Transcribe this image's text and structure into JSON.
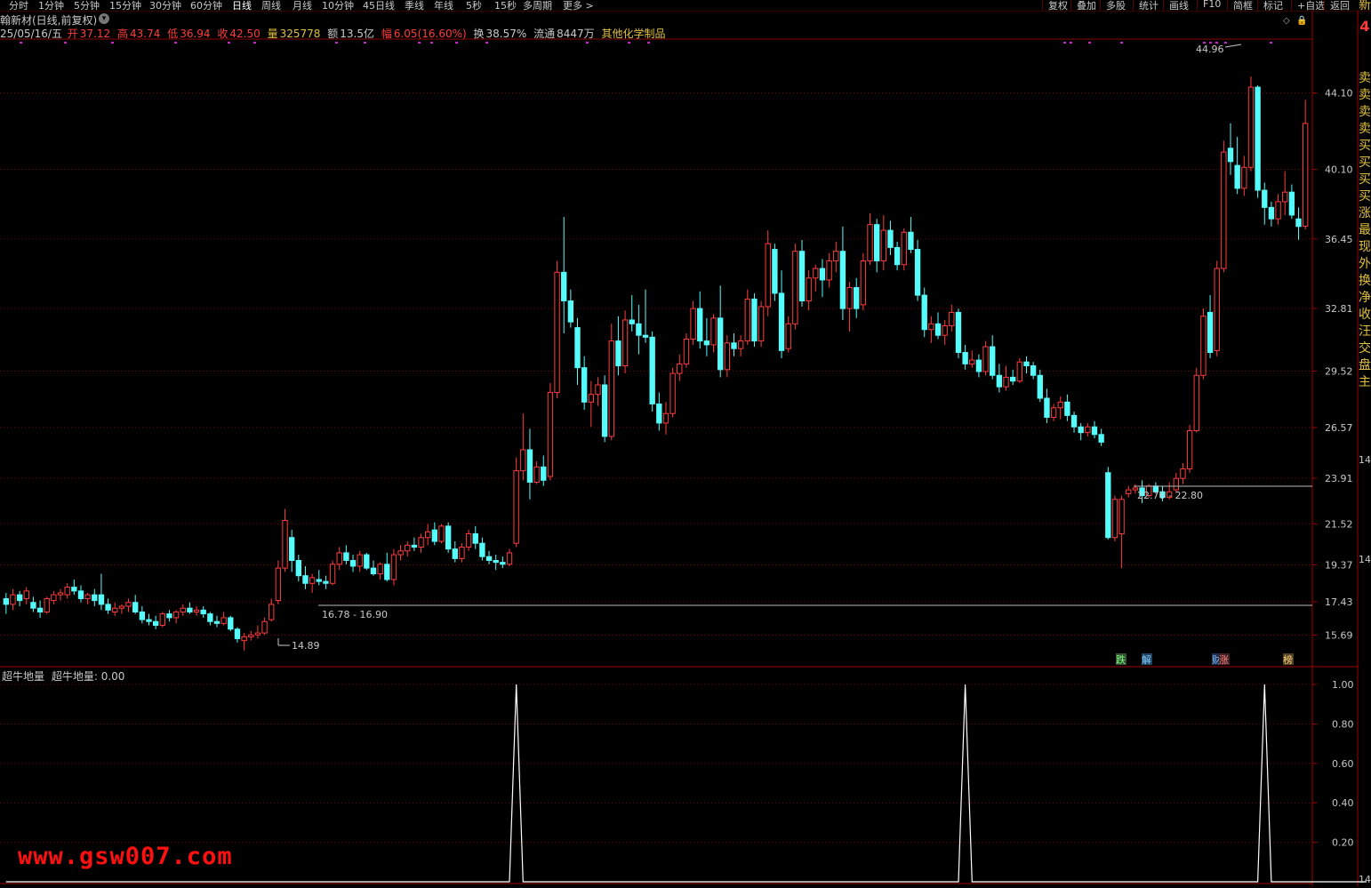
{
  "toolbar": {
    "periods": [
      "分时",
      "1分钟",
      "5分钟",
      "15分钟",
      "30分钟",
      "60分钟",
      "日线",
      "周线",
      "月线",
      "10分钟",
      "45日线",
      "季线",
      "年线",
      "5秒",
      "15秒",
      "多周期",
      "更多 >"
    ],
    "active_period": "日线",
    "right_items": [
      "复权",
      "叠加",
      "多股",
      "统计",
      "画线",
      "F10",
      "简框",
      "标记",
      "+自选",
      "返回"
    ]
  },
  "header": {
    "title": "翰新材(日线,前复权)",
    "info": {
      "date": "25/05/16/五",
      "open_label": "开",
      "open": "37.12",
      "high_label": "高",
      "high": "43.74",
      "low_label": "低",
      "low": "36.94",
      "close_label": "收",
      "close": "42.50",
      "volume_label": "量",
      "volume": "325778",
      "amount_label": "额",
      "amount": "13.5亿",
      "change_label": "幅",
      "change": "6.05(16.60%)",
      "turnover_label": "换",
      "turnover": "38.57%",
      "float_label": "流通",
      "float": "8447万",
      "industry": "其他化学制品"
    }
  },
  "price_axis": [
    "44.10",
    "40.10",
    "36.45",
    "32.81",
    "29.52",
    "26.57",
    "23.91",
    "21.52",
    "19.37",
    "17.43",
    "15.69"
  ],
  "annotations": {
    "high_marker": "44.96",
    "low_marker": "14.89",
    "range_left": "16.78 - 16.90",
    "range_right": "22.76 - 22.80"
  },
  "event_tags": [
    "跌",
    "解",
    "财",
    "涨",
    "榜"
  ],
  "side_panel": {
    "top_label": "新",
    "top_value": "4",
    "labels": [
      "卖",
      "卖",
      "卖",
      "卖",
      "买",
      "买",
      "买",
      "买",
      "涨",
      "最",
      "现",
      "外",
      "换",
      "净",
      "收",
      "汪",
      "交",
      "盘",
      "主"
    ],
    "axis_numbers": [
      "14",
      "14",
      "14"
    ]
  },
  "indicator": {
    "name": "超牛地量",
    "value_label": "超牛地量:",
    "value": "0.00",
    "axis": [
      "1.00",
      "0.80",
      "0.60",
      "0.40",
      "0.20"
    ]
  },
  "watermark": "www.gsw007.com",
  "colors": {
    "up": "#ff3c3c",
    "down": "#54fcfc",
    "grid": "#7a0000",
    "accent": "#e0c040",
    "signal_dot": "#d020d0"
  },
  "chart_data": {
    "type": "candlestick",
    "ylim": [
      14.5,
      46.5
    ],
    "candles": [
      [
        17.6,
        17.9,
        16.8,
        17.3
      ],
      [
        17.3,
        18.1,
        17.0,
        17.8
      ],
      [
        17.8,
        18.0,
        17.2,
        17.5
      ],
      [
        17.6,
        18.2,
        17.3,
        18.0
      ],
      [
        17.4,
        17.7,
        16.9,
        17.1
      ],
      [
        17.1,
        17.5,
        16.6,
        16.9
      ],
      [
        16.9,
        17.7,
        16.8,
        17.6
      ],
      [
        17.5,
        18.0,
        17.3,
        17.8
      ],
      [
        17.8,
        18.1,
        17.5,
        17.9
      ],
      [
        17.8,
        18.4,
        17.6,
        18.2
      ],
      [
        18.2,
        18.6,
        17.8,
        18.0
      ],
      [
        18.0,
        18.3,
        17.4,
        17.6
      ],
      [
        17.6,
        17.9,
        17.3,
        17.8
      ],
      [
        17.8,
        18.1,
        17.2,
        17.5
      ],
      [
        17.8,
        18.9,
        17.0,
        17.3
      ],
      [
        17.3,
        17.6,
        16.8,
        17.0
      ],
      [
        16.9,
        17.4,
        16.7,
        17.1
      ],
      [
        17.1,
        17.3,
        16.8,
        17.2
      ],
      [
        17.2,
        17.6,
        16.9,
        17.4
      ],
      [
        17.4,
        17.8,
        16.8,
        16.9
      ],
      [
        16.9,
        17.2,
        16.3,
        16.5
      ],
      [
        16.5,
        16.8,
        16.2,
        16.4
      ],
      [
        16.4,
        16.7,
        16.0,
        16.2
      ],
      [
        16.2,
        16.9,
        16.1,
        16.8
      ],
      [
        16.8,
        17.0,
        16.4,
        16.6
      ],
      [
        16.6,
        17.0,
        16.3,
        16.9
      ],
      [
        16.9,
        17.3,
        16.7,
        17.1
      ],
      [
        17.1,
        17.4,
        16.8,
        16.9
      ],
      [
        16.9,
        17.2,
        16.7,
        17.0
      ],
      [
        17.0,
        17.2,
        16.6,
        16.8
      ],
      [
        16.8,
        16.9,
        16.2,
        16.4
      ],
      [
        16.4,
        16.7,
        16.1,
        16.3
      ],
      [
        16.3,
        16.9,
        16.2,
        16.6
      ],
      [
        16.6,
        16.7,
        15.9,
        16.0
      ],
      [
        16.0,
        16.1,
        15.3,
        15.5
      ],
      [
        15.4,
        15.8,
        14.89,
        15.6
      ],
      [
        15.6,
        15.9,
        15.4,
        15.7
      ],
      [
        15.7,
        16.2,
        15.5,
        15.8
      ],
      [
        15.8,
        16.6,
        15.7,
        16.4
      ],
      [
        16.5,
        17.6,
        16.4,
        17.3
      ],
      [
        17.5,
        19.6,
        17.3,
        19.2
      ],
      [
        19.2,
        22.3,
        19.0,
        21.7
      ],
      [
        20.8,
        21.2,
        19.0,
        19.6
      ],
      [
        19.6,
        19.9,
        18.5,
        18.8
      ],
      [
        18.8,
        19.3,
        18.1,
        18.4
      ],
      [
        18.4,
        18.9,
        17.9,
        18.7
      ],
      [
        18.6,
        19.1,
        18.3,
        18.5
      ],
      [
        18.5,
        18.8,
        18.1,
        18.4
      ],
      [
        18.4,
        19.6,
        18.3,
        19.4
      ],
      [
        19.4,
        20.3,
        19.1,
        20.0
      ],
      [
        20.0,
        20.4,
        19.4,
        19.6
      ],
      [
        19.6,
        19.9,
        19.0,
        19.3
      ],
      [
        19.3,
        20.1,
        19.0,
        19.9
      ],
      [
        19.9,
        20.0,
        19.1,
        19.2
      ],
      [
        19.2,
        19.6,
        18.8,
        18.9
      ],
      [
        18.9,
        19.5,
        18.6,
        19.4
      ],
      [
        19.4,
        20.0,
        18.5,
        18.6
      ],
      [
        18.6,
        20.2,
        18.3,
        19.9
      ],
      [
        19.9,
        20.4,
        19.6,
        20.1
      ],
      [
        20.1,
        20.6,
        19.8,
        20.4
      ],
      [
        20.4,
        20.8,
        20.1,
        20.3
      ],
      [
        20.3,
        21.0,
        20.0,
        20.8
      ],
      [
        20.8,
        21.5,
        20.4,
        21.1
      ],
      [
        21.2,
        21.6,
        20.4,
        20.6
      ],
      [
        20.6,
        21.5,
        20.5,
        21.4
      ],
      [
        21.4,
        21.6,
        20.0,
        20.2
      ],
      [
        20.2,
        20.6,
        19.5,
        19.7
      ],
      [
        19.7,
        20.5,
        19.5,
        20.3
      ],
      [
        20.3,
        21.2,
        20.1,
        21.0
      ],
      [
        21.0,
        21.4,
        20.2,
        20.5
      ],
      [
        20.5,
        20.8,
        19.6,
        19.8
      ],
      [
        19.8,
        20.1,
        19.4,
        19.6
      ],
      [
        19.6,
        19.9,
        19.1,
        19.5
      ],
      [
        19.5,
        19.8,
        19.2,
        19.4
      ],
      [
        19.4,
        20.2,
        19.3,
        20.0
      ],
      [
        20.5,
        25.0,
        20.3,
        24.3
      ],
      [
        24.3,
        27.3,
        23.8,
        25.4
      ],
      [
        25.4,
        26.5,
        22.8,
        23.7
      ],
      [
        23.7,
        24.8,
        23.6,
        24.5
      ],
      [
        24.5,
        25.1,
        23.5,
        23.8
      ],
      [
        24.0,
        28.9,
        23.8,
        28.4
      ],
      [
        28.4,
        35.3,
        28.1,
        34.7
      ],
      [
        34.7,
        37.6,
        31.5,
        33.2
      ],
      [
        33.2,
        33.8,
        31.8,
        32.1
      ],
      [
        31.8,
        32.3,
        28.8,
        29.7
      ],
      [
        29.7,
        30.3,
        27.5,
        27.9
      ],
      [
        27.9,
        29.0,
        26.6,
        28.3
      ],
      [
        28.3,
        29.2,
        27.7,
        28.8
      ],
      [
        28.8,
        29.3,
        25.8,
        26.1
      ],
      [
        26.1,
        32.0,
        25.9,
        31.1
      ],
      [
        31.1,
        32.4,
        29.3,
        29.8
      ],
      [
        29.8,
        32.7,
        29.4,
        32.2
      ],
      [
        32.2,
        33.5,
        31.6,
        32.0
      ],
      [
        32.0,
        33.0,
        30.4,
        31.4
      ],
      [
        31.4,
        33.8,
        31.0,
        31.3
      ],
      [
        31.3,
        31.6,
        27.4,
        27.8
      ],
      [
        27.8,
        28.4,
        26.4,
        26.8
      ],
      [
        26.8,
        27.9,
        26.2,
        27.3
      ],
      [
        27.3,
        29.7,
        27.1,
        29.4
      ],
      [
        29.4,
        30.4,
        29.0,
        29.9
      ],
      [
        29.9,
        31.5,
        29.7,
        31.2
      ],
      [
        31.2,
        33.2,
        30.9,
        32.8
      ],
      [
        32.8,
        33.7,
        30.7,
        31.1
      ],
      [
        31.1,
        32.3,
        30.3,
        30.9
      ],
      [
        30.9,
        32.5,
        30.5,
        32.3
      ],
      [
        32.3,
        34.0,
        29.2,
        29.6
      ],
      [
        29.6,
        31.4,
        29.2,
        31.0
      ],
      [
        31.0,
        31.5,
        30.3,
        30.7
      ],
      [
        30.7,
        31.4,
        30.3,
        31.1
      ],
      [
        31.1,
        33.8,
        30.9,
        33.3
      ],
      [
        33.3,
        33.6,
        30.8,
        31.1
      ],
      [
        31.1,
        33.2,
        30.8,
        32.9
      ],
      [
        32.9,
        36.9,
        32.4,
        36.2
      ],
      [
        35.9,
        36.2,
        33.2,
        33.6
      ],
      [
        33.6,
        34.8,
        30.2,
        30.6
      ],
      [
        30.7,
        32.4,
        30.5,
        32.0
      ],
      [
        32.0,
        36.2,
        31.7,
        35.8
      ],
      [
        35.8,
        36.4,
        32.9,
        33.2
      ],
      [
        33.2,
        34.8,
        32.7,
        34.4
      ],
      [
        34.4,
        35.1,
        33.7,
        34.9
      ],
      [
        34.9,
        35.4,
        33.4,
        34.3
      ],
      [
        34.3,
        35.7,
        33.9,
        35.3
      ],
      [
        35.3,
        36.3,
        34.7,
        35.8
      ],
      [
        35.8,
        37.1,
        32.2,
        32.8
      ],
      [
        32.8,
        34.2,
        31.6,
        33.9
      ],
      [
        33.9,
        34.4,
        32.3,
        32.8
      ],
      [
        33.0,
        35.7,
        32.7,
        35.3
      ],
      [
        35.3,
        37.8,
        35.1,
        37.2
      ],
      [
        37.2,
        37.5,
        34.7,
        35.3
      ],
      [
        35.3,
        37.7,
        34.8,
        36.9
      ],
      [
        36.9,
        37.4,
        35.6,
        36.0
      ],
      [
        36.0,
        36.3,
        34.8,
        35.1
      ],
      [
        35.1,
        37.0,
        34.8,
        36.8
      ],
      [
        36.8,
        37.6,
        35.7,
        35.9
      ],
      [
        35.9,
        36.4,
        33.2,
        33.5
      ],
      [
        33.5,
        33.9,
        31.3,
        31.7
      ],
      [
        31.7,
        32.4,
        31.0,
        32.0
      ],
      [
        32.0,
        32.6,
        31.2,
        31.4
      ],
      [
        31.4,
        32.2,
        30.9,
        31.9
      ],
      [
        31.9,
        33.0,
        31.6,
        32.6
      ],
      [
        32.6,
        32.8,
        30.2,
        30.5
      ],
      [
        30.5,
        30.9,
        29.6,
        29.9
      ],
      [
        29.9,
        30.6,
        29.7,
        30.1
      ],
      [
        30.1,
        30.4,
        29.2,
        29.5
      ],
      [
        29.5,
        31.1,
        29.3,
        30.8
      ],
      [
        30.8,
        31.4,
        29.1,
        29.3
      ],
      [
        29.3,
        29.9,
        28.4,
        28.7
      ],
      [
        28.7,
        29.8,
        28.5,
        29.2
      ],
      [
        29.2,
        29.6,
        28.8,
        29.0
      ],
      [
        29.0,
        30.2,
        28.9,
        30.0
      ],
      [
        30.0,
        30.3,
        29.4,
        29.8
      ],
      [
        29.8,
        30.0,
        29.1,
        29.3
      ],
      [
        29.3,
        29.6,
        27.9,
        28.1
      ],
      [
        28.1,
        28.6,
        26.8,
        27.1
      ],
      [
        27.1,
        27.8,
        26.9,
        27.6
      ],
      [
        27.6,
        28.2,
        27.0,
        27.9
      ],
      [
        27.9,
        28.3,
        26.9,
        27.2
      ],
      [
        27.2,
        27.4,
        26.3,
        26.6
      ],
      [
        26.6,
        26.8,
        25.9,
        26.3
      ],
      [
        26.3,
        26.8,
        26.1,
        26.6
      ],
      [
        26.6,
        26.9,
        26.0,
        26.2
      ],
      [
        26.2,
        26.5,
        25.6,
        25.8
      ],
      [
        24.2,
        24.5,
        20.7,
        20.8
      ],
      [
        20.8,
        23.0,
        20.6,
        22.8
      ],
      [
        21.0,
        23.0,
        19.2,
        22.8
      ],
      [
        23.1,
        23.5,
        22.9,
        23.3
      ],
      [
        23.3,
        23.6,
        23.1,
        23.4
      ],
      [
        23.4,
        23.8,
        22.6,
        23.0
      ],
      [
        23.0,
        23.6,
        22.9,
        23.5
      ],
      [
        23.5,
        23.7,
        23.1,
        23.2
      ],
      [
        23.2,
        23.5,
        22.7,
        22.9
      ],
      [
        22.9,
        23.7,
        22.8,
        23.2
      ],
      [
        23.3,
        24.2,
        23.2,
        23.9
      ],
      [
        23.9,
        24.7,
        23.6,
        24.4
      ],
      [
        24.4,
        26.7,
        24.2,
        26.4
      ],
      [
        26.4,
        29.7,
        26.3,
        29.3
      ],
      [
        29.3,
        32.8,
        29.1,
        32.4
      ],
      [
        32.6,
        33.5,
        30.2,
        30.5
      ],
      [
        30.6,
        35.3,
        30.3,
        34.9
      ],
      [
        34.9,
        41.6,
        34.7,
        41.0
      ],
      [
        41.2,
        42.5,
        39.8,
        40.5
      ],
      [
        40.3,
        41.8,
        38.8,
        39.1
      ],
      [
        39.1,
        40.8,
        38.7,
        40.2
      ],
      [
        40.2,
        44.96,
        40.0,
        44.4
      ],
      [
        44.4,
        44.5,
        38.6,
        39.0
      ],
      [
        39.0,
        39.4,
        37.2,
        38.1
      ],
      [
        38.1,
        38.4,
        37.1,
        37.5
      ],
      [
        37.5,
        38.8,
        37.2,
        38.4
      ],
      [
        38.4,
        40.0,
        37.7,
        38.9
      ],
      [
        38.9,
        39.3,
        37.5,
        37.7
      ],
      [
        37.5,
        38.1,
        36.4,
        37.1
      ],
      [
        37.12,
        43.74,
        36.94,
        42.5
      ]
    ],
    "signals": [
      0,
      0,
      0,
      0,
      0,
      0,
      0,
      0,
      0,
      0,
      0,
      0,
      0,
      0,
      0,
      0,
      0,
      0,
      0,
      0,
      0,
      0,
      0,
      0,
      0,
      0,
      0,
      0,
      0,
      0,
      0,
      0,
      0,
      0,
      0,
      0,
      0,
      0,
      0,
      0,
      0,
      0,
      0,
      0,
      0,
      0,
      0,
      0,
      0,
      0,
      0,
      0,
      0,
      0,
      0,
      0,
      0,
      0,
      0,
      0,
      0,
      0,
      0,
      0,
      0,
      0,
      0,
      0,
      0,
      0,
      0,
      0,
      0,
      0,
      0,
      1,
      0,
      0,
      0,
      0,
      0,
      0,
      0,
      0,
      0,
      0,
      0,
      0,
      0,
      0,
      0,
      0,
      0,
      0,
      0,
      0,
      0,
      0,
      0,
      0,
      0,
      0,
      0,
      0,
      0,
      0,
      0,
      0,
      0,
      0,
      0,
      0,
      0,
      0,
      0,
      0,
      0,
      0,
      0,
      0,
      0,
      0,
      0,
      0,
      0,
      0,
      0,
      0,
      0,
      0,
      0,
      0,
      0,
      0,
      0,
      0,
      0,
      0,
      0,
      0,
      0,
      1,
      0,
      0,
      0,
      0,
      0,
      0,
      0,
      0,
      0,
      0,
      0,
      0,
      0,
      0,
      0,
      0,
      0,
      0,
      0,
      0,
      0,
      0,
      0,
      0,
      0,
      0,
      0,
      0,
      0,
      0,
      0,
      0,
      0,
      0,
      0,
      0,
      0,
      0,
      0,
      0,
      0,
      0,
      0,
      1,
      0,
      0,
      0,
      0,
      0,
      0,
      0,
      0,
      0,
      0,
      0,
      0,
      0,
      0,
      0
    ]
  }
}
